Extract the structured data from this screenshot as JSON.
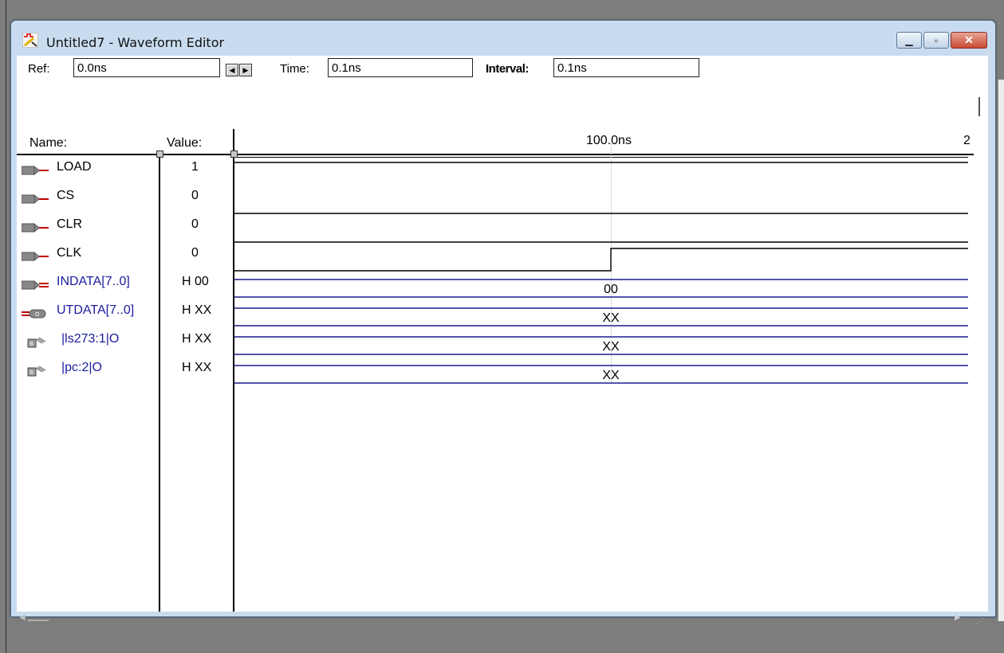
{
  "window": {
    "title": "Untitled7 - Waveform Editor"
  },
  "toolbar": {
    "ref_label": "Ref:",
    "ref_value": "0.0ns",
    "time_label": "Time:",
    "time_value": "0.1ns",
    "interval_label": "Interval:",
    "interval_value": "0.1ns"
  },
  "headers": {
    "name": "Name:",
    "value": "Value:",
    "time_marker": "100.0ns",
    "time_marker_next": "2"
  },
  "signals": [
    {
      "name": "LOAD",
      "value": "1",
      "type": "input",
      "bus": false,
      "level_before_100ns": 1,
      "level_after_100ns": 1
    },
    {
      "name": "CS",
      "value": "0",
      "type": "input",
      "bus": false,
      "level_before_100ns": 0,
      "level_after_100ns": 0
    },
    {
      "name": "CLR",
      "value": "0",
      "type": "input",
      "bus": false,
      "level_before_100ns": 0,
      "level_after_100ns": 0
    },
    {
      "name": "CLK",
      "value": "0",
      "type": "input",
      "bus": false,
      "level_before_100ns": 0,
      "level_after_100ns": 1
    },
    {
      "name": "INDATA[7..0]",
      "value": "H 00",
      "type": "input-bus",
      "bus": true,
      "bus_text": "00"
    },
    {
      "name": "UTDATA[7..0]",
      "value": "H XX",
      "type": "output-bus",
      "bus": true,
      "bus_text": "XX"
    },
    {
      "name": "|ls273:1|O",
      "value": "H XX",
      "type": "buried-bus",
      "bus": true,
      "bus_text": "XX"
    },
    {
      "name": "|pc:2|O",
      "value": "H XX",
      "type": "buried-bus",
      "bus": true,
      "bus_text": "XX"
    }
  ],
  "colors": {
    "input_icon": "#c00000",
    "bus_text": "#1c1ca0",
    "bus_wave": "#1c1c8c",
    "title_bar": "#c9dcef"
  }
}
